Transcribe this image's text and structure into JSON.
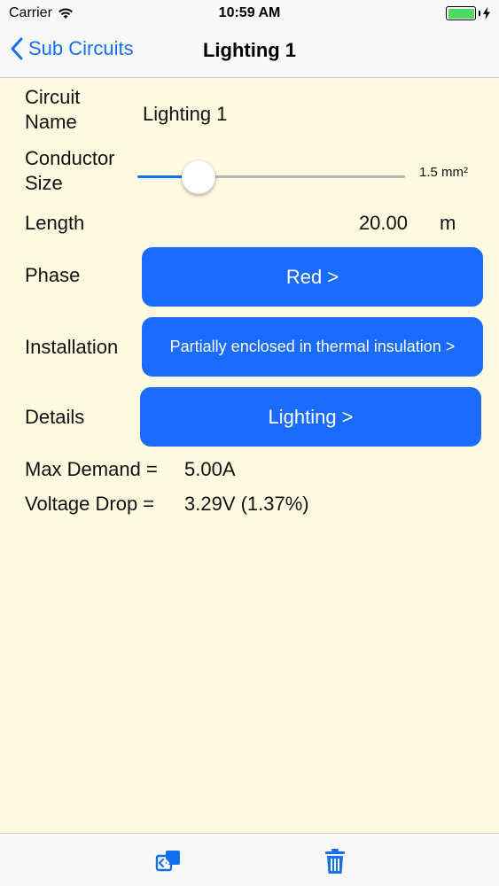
{
  "status_bar": {
    "carrier": "Carrier",
    "time": "10:59 AM"
  },
  "nav": {
    "back_label": "Sub Circuits",
    "title": "Lighting 1"
  },
  "form": {
    "circuit_name_label_line1": "Circuit",
    "circuit_name_label_line2": "Name",
    "circuit_name_value": "Lighting 1",
    "conductor_label_line1": "Conductor",
    "conductor_label_line2": "Size",
    "conductor_slider_fraction": 0.23,
    "conductor_value": "1.5 mm²",
    "length_label": "Length",
    "length_value": "20.00",
    "length_unit": "m",
    "phase_label": "Phase",
    "phase_button": "Red >",
    "installation_label": "Installation",
    "installation_button": "Partially enclosed in thermal insulation >",
    "details_label": "Details",
    "details_button": "Lighting >"
  },
  "results": {
    "max_demand_label": "Max Demand =",
    "max_demand_value": "5.00A",
    "voltage_drop_label": "Voltage Drop =",
    "voltage_drop_value": "3.29V (1.37%)"
  },
  "colors": {
    "accent": "#1a6bff",
    "background": "#fffbe0",
    "battery": "#4cd964"
  },
  "toolbar": {
    "icons": [
      "duplicate-icon",
      "trash-icon"
    ]
  }
}
